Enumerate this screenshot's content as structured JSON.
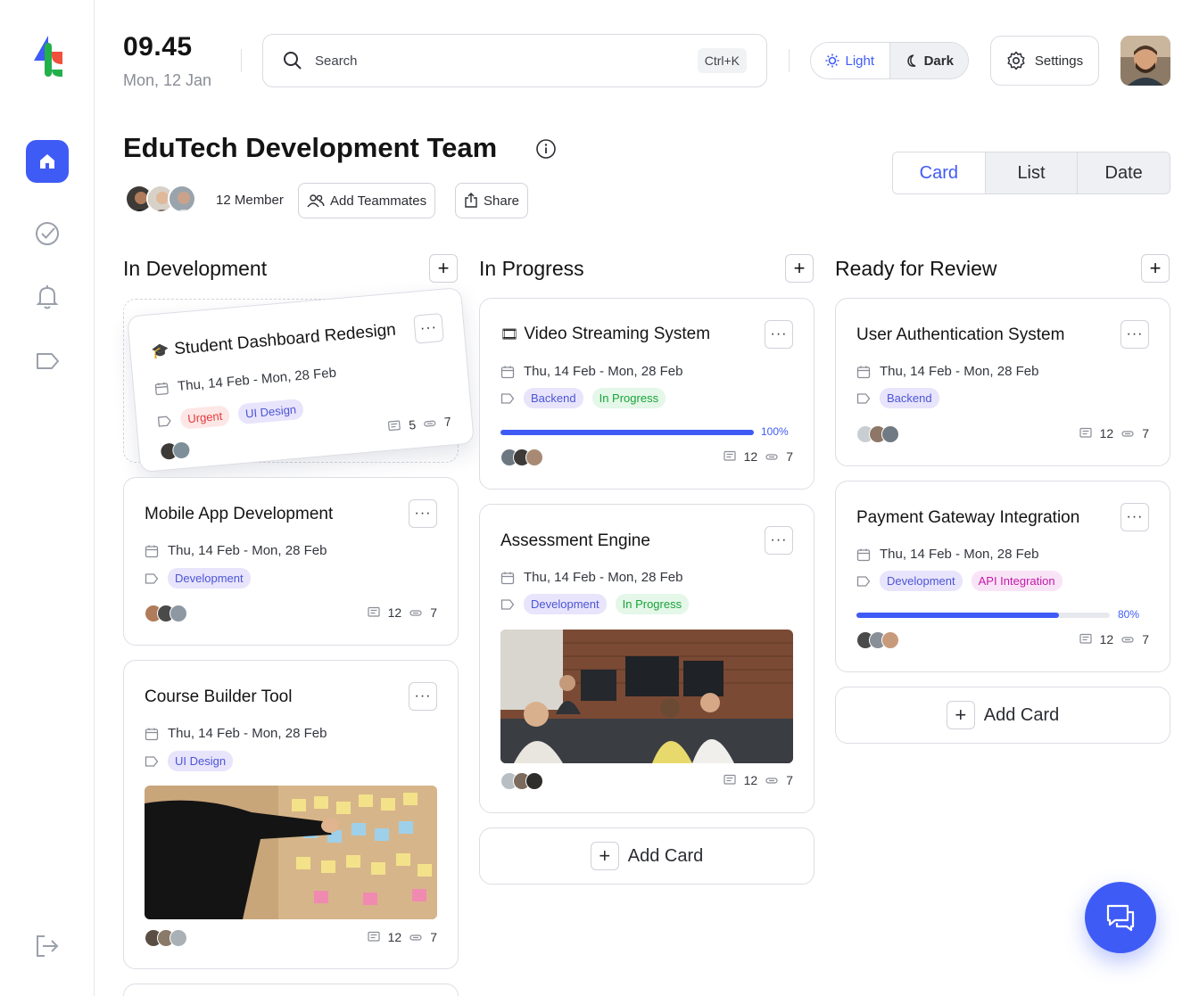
{
  "header": {
    "time": "09.45",
    "date": "Mon, 12 Jan",
    "search_placeholder": "Search",
    "search_shortcut": "Ctrl+K",
    "theme_light": "Light",
    "theme_dark": "Dark",
    "settings_label": "Settings"
  },
  "team": {
    "title": "EduTech Development Team",
    "member_count": "12 Member",
    "add_teammates": "Add Teammates",
    "share": "Share"
  },
  "views": {
    "card": "Card",
    "list": "List",
    "date": "Date",
    "active": "Card"
  },
  "columns": [
    {
      "title": "In Development"
    },
    {
      "title": "In Progress"
    },
    {
      "title": "Ready for Review"
    }
  ],
  "cards": {
    "student_dashboard": {
      "emoji": "🎓",
      "title": "Student Dashboard Redesign",
      "dates": "Thu, 14 Feb - Mon, 28 Feb",
      "tags": [
        "Urgent",
        "UI Design"
      ],
      "comments": "5",
      "attachments": "7"
    },
    "mobile_app": {
      "title": "Mobile App Development",
      "dates": "Thu, 14 Feb - Mon, 28 Feb",
      "tags": [
        "Development"
      ],
      "comments": "12",
      "attachments": "7"
    },
    "course_builder": {
      "title": "Course Builder Tool",
      "dates": "Thu, 14 Feb - Mon, 28 Feb",
      "tags": [
        "UI Design"
      ],
      "comments": "12",
      "attachments": "7"
    },
    "video_streaming": {
      "emoji": "🎞",
      "title": "Video Streaming System",
      "dates": "Thu, 14 Feb - Mon, 28 Feb",
      "tags": [
        "Backend",
        "In Progress"
      ],
      "progress": 100,
      "progress_label": "100%",
      "comments": "12",
      "attachments": "7"
    },
    "assessment": {
      "title": "Assessment Engine",
      "dates": "Thu, 14 Feb - Mon, 28 Feb",
      "tags": [
        "Development",
        "In Progress"
      ],
      "comments": "12",
      "attachments": "7"
    },
    "user_auth": {
      "title": "User Authentication System",
      "dates": "Thu, 14 Feb - Mon, 28 Feb",
      "tags": [
        "Backend"
      ],
      "comments": "12",
      "attachments": "7"
    },
    "payment": {
      "title": "Payment Gateway Integration",
      "dates": "Thu, 14 Feb - Mon, 28 Feb",
      "tags": [
        "Development",
        "API Integration"
      ],
      "progress": 80,
      "progress_label": "80%",
      "comments": "12",
      "attachments": "7"
    }
  },
  "add_card": "Add Card",
  "colors": {
    "accent": "#3f5bf6",
    "green": "#19a33a",
    "red": "#e53a3a",
    "pink": "#c41aa8"
  }
}
